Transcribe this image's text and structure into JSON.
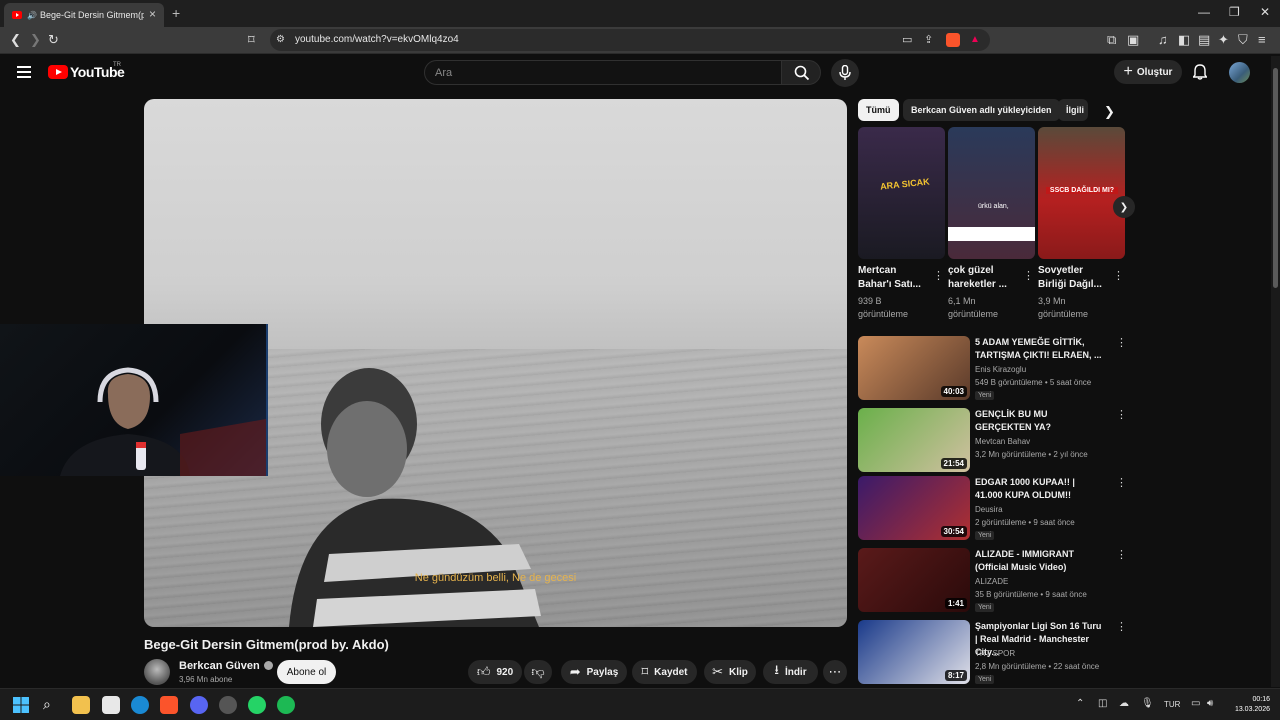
{
  "browser": {
    "tab_title": "Bege-Git Dersin Gitmem(prod. by. Akdo) - YouTube",
    "url": "youtube.com/watch?v=ekvOMlq4zo4"
  },
  "header": {
    "logo_text": "YouTube",
    "country_code": "TR",
    "search_placeholder": "Ara",
    "create_label": "Oluştur"
  },
  "video": {
    "subtitle": "Ne gündüzüm belli, Ne de gecesi",
    "title": "Bege-Git Dersin Gitmem(prod by. Akdo)",
    "channel": "Berkcan Güven",
    "subscribers": "3,96 Mn abone",
    "subscribe_label": "Abone ol",
    "likes": "920",
    "share_label": "Paylaş",
    "save_label": "Kaydet",
    "clip_label": "Klip",
    "download_label": "İndir"
  },
  "chips": [
    "Tümü",
    "Berkcan Güven adlı yükleyiciden",
    "İlgili"
  ],
  "shorts": [
    {
      "title": "Mertcan Bahar'ı Satı...",
      "views_a": "939 B",
      "views_b": "görüntüleme",
      "overlay": "ARA SICAK",
      "colors": [
        "#3a2a4a",
        "#1a1a22"
      ]
    },
    {
      "title": "çok güzel hareketler ...",
      "views_a": "6,1 Mn",
      "views_b": "görüntüleme",
      "overlay": "ürkü alan,",
      "colors": [
        "#2a3a5a",
        "#4a2a3a"
      ]
    },
    {
      "title": "Sovyetler Birliği Dağıl...",
      "views_a": "3,9 Mn",
      "views_b": "görüntüleme",
      "overlay": "SSCB DAĞILDI MI?",
      "colors": [
        "#8a1a1a",
        "#b52020"
      ]
    }
  ],
  "recommendations": [
    {
      "title": "5 ADAM YEMEĞE GİTTİK, TARTIŞMA ÇIKTI! ELRAEN, ...",
      "channel": "Enis Kirazoglu",
      "meta": "549 B görüntüleme • 5 saat önce",
      "duration": "40:03",
      "badge": "Yeni",
      "colors": [
        "#c98a5a",
        "#5a3a2a"
      ]
    },
    {
      "title": "GENÇLİK BU MU GERÇEKTEN YA?",
      "channel": "Mevtcan Bahav",
      "meta": "3,2 Mn görüntüleme • 2 yıl önce",
      "duration": "21:54",
      "badge": "",
      "colors": [
        "#6ab04a",
        "#d0c0a0"
      ]
    },
    {
      "title": "EDGAR 1000 KUPAA!! | 41.000 KUPA OLDUM!!",
      "channel": "Deusira",
      "meta": "2 görüntüleme • 9 saat önce",
      "duration": "30:54",
      "badge": "Yeni",
      "colors": [
        "#3a1a6a",
        "#b03030"
      ]
    },
    {
      "title": "ALIZADE - IMMIGRANT (Official Music Video)",
      "channel": "ALIZADE",
      "meta": "35 B görüntüleme • 9 saat önce",
      "duration": "1:41",
      "badge": "Yeni",
      "colors": [
        "#5a1a1a",
        "#2a0a0a"
      ]
    },
    {
      "title": "Şampiyonlar Ligi Son 16 Turu | Real Madrid - Manchester City...",
      "channel": "TRT SPOR",
      "meta": "2,8 Mn görüntüleme • 22 saat önce",
      "duration": "8:17",
      "badge": "Yeni",
      "colors": [
        "#1a3a8a",
        "#e0e0e8"
      ]
    }
  ],
  "taskbar": {
    "lang": "TUR",
    "time": "00:16",
    "date": "13.03.2026"
  }
}
